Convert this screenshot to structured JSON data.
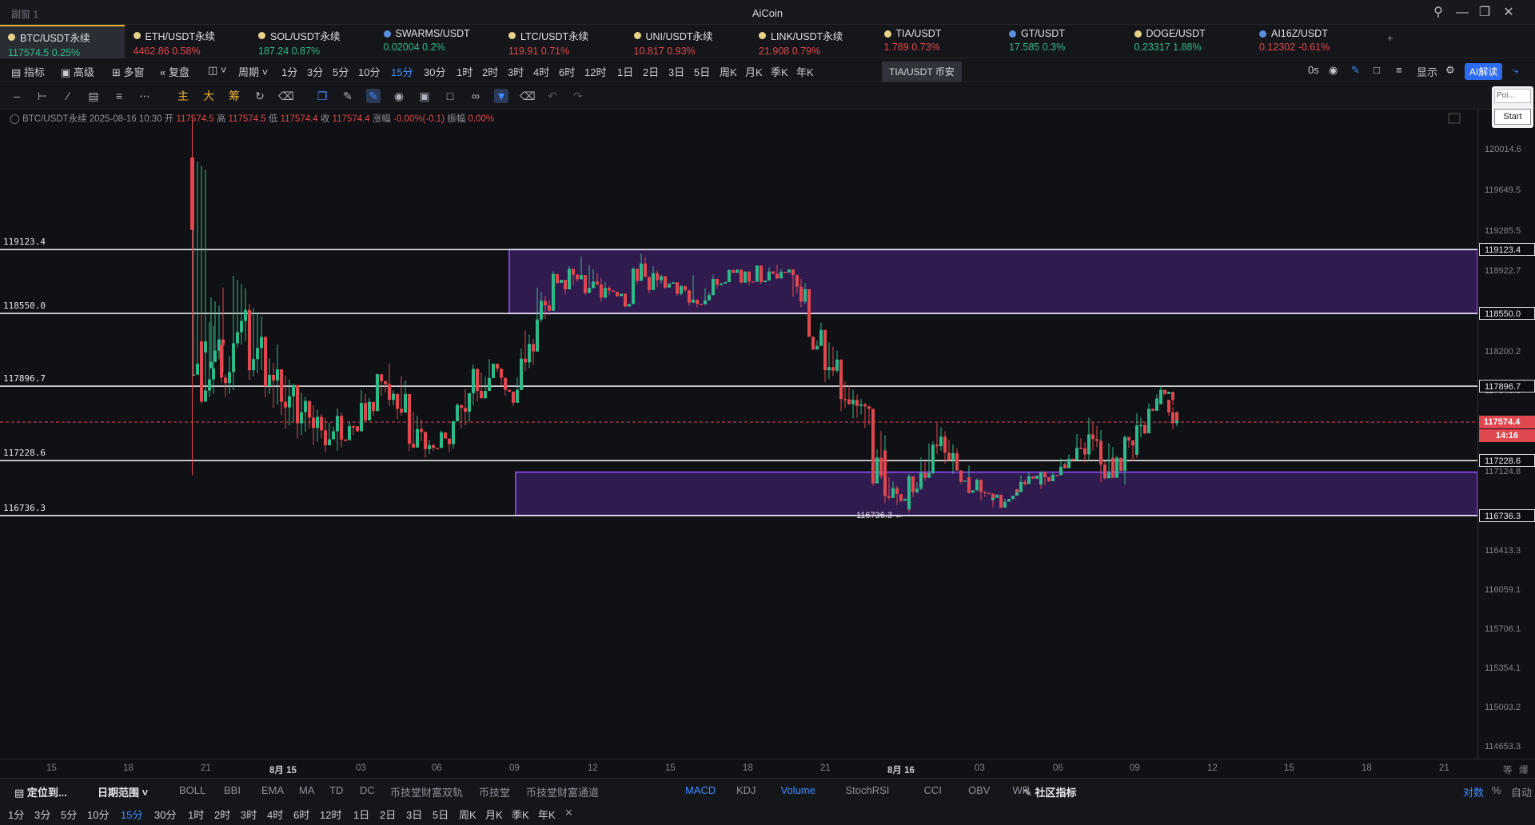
{
  "window": {
    "sub_title": "副窗 1",
    "app_title": "AiCoin"
  },
  "tickers": [
    {
      "name": "BTC/USDT永续",
      "price": "117574.5",
      "change": "0.25%",
      "dir": "up",
      "dot": "gold",
      "active": true
    },
    {
      "name": "ETH/USDT永续",
      "price": "4462.86",
      "change": "0.58%",
      "dir": "dn",
      "dot": "gold"
    },
    {
      "name": "SOL/USDT永续",
      "price": "187.24",
      "change": "0.87%",
      "dir": "up",
      "dot": "gold"
    },
    {
      "name": "SWARMS/USDT",
      "price": "0.02004",
      "change": "0.2%",
      "dir": "up",
      "dot": "blue"
    },
    {
      "name": "LTC/USDT永续",
      "price": "119.91",
      "change": "0.71%",
      "dir": "dn",
      "dot": "gold"
    },
    {
      "name": "UNI/USDT永续",
      "price": "10.817",
      "change": "0.93%",
      "dir": "dn",
      "dot": "gold"
    },
    {
      "name": "LINK/USDT永续",
      "price": "21.908",
      "change": "0.79%",
      "dir": "dn",
      "dot": "gold"
    },
    {
      "name": "TIA/USDT",
      "price": "1.789",
      "change": "0.73%",
      "dir": "dn",
      "dot": "gold"
    },
    {
      "name": "GT/USDT",
      "price": "17.585",
      "change": "0.3%",
      "dir": "up",
      "dot": "blue"
    },
    {
      "name": "DOGE/USDT",
      "price": "0.23317",
      "change": "1.88%",
      "dir": "up",
      "dot": "gold"
    },
    {
      "name": "AI16Z/USDT",
      "price": "0.12302",
      "change": "-0.61%",
      "dir": "dn",
      "dot": "blue"
    }
  ],
  "add_tab": "+",
  "toolbar": {
    "indicators": "指标",
    "advanced": "高级",
    "multi": "多窗",
    "replay": "复盘",
    "period": "周期",
    "periods": [
      "1分",
      "3分",
      "5分",
      "10分",
      "15分",
      "30分",
      "1时",
      "2时",
      "3时",
      "4时",
      "6时",
      "12时",
      "1日",
      "2日",
      "3日",
      "5日",
      "周K",
      "月K",
      "季K",
      "年K"
    ],
    "selected_period": "15分",
    "tooltip": "TIA/USDT 币安",
    "countdown": "0s",
    "display": "显示",
    "ai_button": "AI解读"
  },
  "draw_tools": {
    "main": "主",
    "big": "大",
    "chip": "筹"
  },
  "ohlc_bar": {
    "symbol": "BTC/USDT永续",
    "datetime": "2025-08-16 10:30",
    "open_label": "开",
    "open": "117574.5",
    "high_label": "高",
    "high": "117574.5",
    "low_label": "低",
    "low": "117574.4",
    "close_label": "收",
    "close": "117574.4",
    "change_label": "涨幅",
    "change": "-0.00%(-0.1)",
    "amp_label": "振幅",
    "amp": "0.00%"
  },
  "side_panel": {
    "input_placeholder": "Poi...",
    "start": "Start"
  },
  "horizontal_lines": [
    "119123.4",
    "118550.0",
    "117896.7",
    "117228.6",
    "116736.3"
  ],
  "low_marker": "116736.3",
  "price_axis_labels": [
    "120014.6",
    "119649.5",
    "119285.5",
    "118922.7",
    "118200.2",
    "117848.8",
    "117124.8",
    "116413.3",
    "116059.1",
    "115706.1",
    "115354.1",
    "115003.2",
    "114653.3"
  ],
  "price_axis_tags": {
    "last_price": "117574.4",
    "countdown": "14:16",
    "lines": [
      "119123.4",
      "118550.0",
      "117896.7",
      "117228.6",
      "116736.3"
    ]
  },
  "time_axis": [
    "15",
    "18",
    "21",
    "8月 15",
    "03",
    "06",
    "09",
    "12",
    "15",
    "18",
    "21",
    "8月 16",
    "03",
    "06",
    "09",
    "12",
    "15",
    "18",
    "21"
  ],
  "time_axis_corner": [
    "等",
    "爆"
  ],
  "indicator_bar": {
    "locate": "定位到...",
    "date_range": "日期范围",
    "main_inds": [
      "BOLL",
      "BBI",
      "EMA",
      "MA",
      "TD",
      "DC",
      "币技堂财富双轨",
      "币技堂",
      "币技堂财富通道"
    ],
    "sub_inds": [
      "MACD",
      "KDJ",
      "Volume",
      "StochRSI",
      "CCI",
      "OBV",
      "WR"
    ],
    "community": "社区指标",
    "scale": [
      "对数",
      "%",
      "自动"
    ]
  },
  "period_bar": [
    "1分",
    "3分",
    "5分",
    "10分",
    "15分",
    "30分",
    "1时",
    "2时",
    "3时",
    "4时",
    "6时",
    "12时",
    "1日",
    "2日",
    "3日",
    "5日",
    "周K",
    "月K",
    "季K",
    "年K"
  ],
  "colors": {
    "up": "#2fb98a",
    "down": "#e0474f",
    "zone": "#7b45d6",
    "accent": "#3f8cff"
  }
}
